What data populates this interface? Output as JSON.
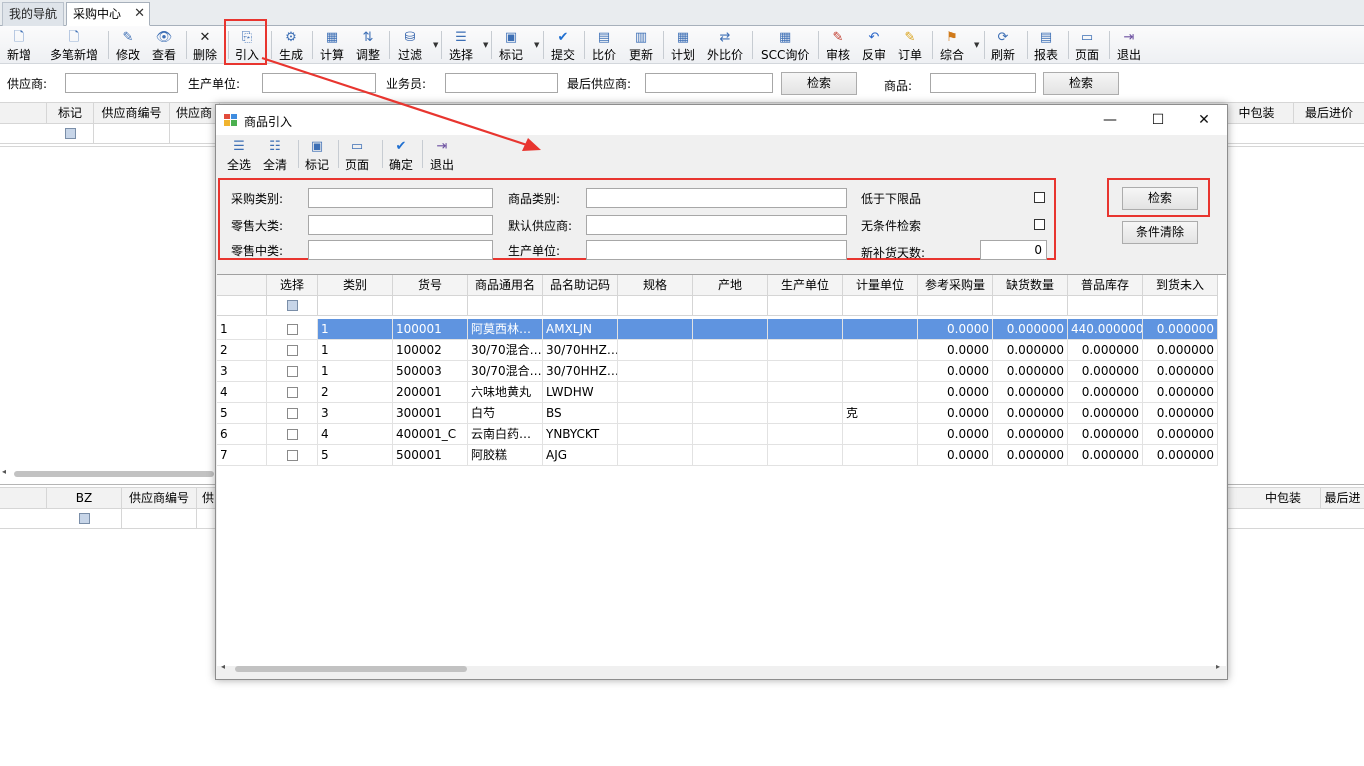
{
  "tabs": [
    "我的导航",
    "采购中心"
  ],
  "tab_close": "✕",
  "toolbar": {
    "items": [
      {
        "label": "新增",
        "icon": "new-doc-icon"
      },
      {
        "label": "多笔新增",
        "icon": "multi-new-icon"
      },
      {
        "label": "修改",
        "icon": "edit-icon"
      },
      {
        "label": "查看",
        "icon": "view-icon"
      },
      {
        "label": "删除",
        "icon": "delete-icon"
      },
      {
        "label": "引入",
        "icon": "import-icon"
      },
      {
        "label": "生成",
        "icon": "generate-icon"
      },
      {
        "label": "计算",
        "icon": "calculate-icon"
      },
      {
        "label": "调整",
        "icon": "adjust-icon"
      },
      {
        "label": "过滤",
        "icon": "filter-icon"
      },
      {
        "label": "选择",
        "icon": "select-icon"
      },
      {
        "label": "标记",
        "icon": "mark-icon"
      },
      {
        "label": "提交",
        "icon": "submit-icon"
      },
      {
        "label": "比价",
        "icon": "compare-price-icon"
      },
      {
        "label": "更新",
        "icon": "update-icon"
      },
      {
        "label": "计划",
        "icon": "plan-icon"
      },
      {
        "label": "外比价",
        "icon": "external-compare-icon"
      },
      {
        "label": "SCC询价",
        "icon": "inquiry-icon"
      },
      {
        "label": "审核",
        "icon": "audit-icon"
      },
      {
        "label": "反审",
        "icon": "unaudit-icon"
      },
      {
        "label": "订单",
        "icon": "order-icon"
      },
      {
        "label": "综合",
        "icon": "combined-icon"
      },
      {
        "label": "刷新",
        "icon": "refresh-icon"
      },
      {
        "label": "报表",
        "icon": "report-icon"
      },
      {
        "label": "页面",
        "icon": "page-icon"
      },
      {
        "label": "退出",
        "icon": "exit-icon"
      }
    ]
  },
  "filter": {
    "supplier_label": "供应商:",
    "maker_label": "生产单位:",
    "salesman_label": "业务员:",
    "last_supplier_label": "最后供应商:",
    "search_btn": "检索",
    "goods_label": "商品:",
    "search_btn2": "检索"
  },
  "top_grid": {
    "headers_left": [
      "标记",
      "供应商编号",
      "供应商"
    ],
    "headers_right": [
      "中包装",
      "最后进价"
    ]
  },
  "bottom_grid": {
    "headers_left": [
      "BZ",
      "供应商编号",
      "供"
    ],
    "headers_right": [
      "中包装",
      "最后进"
    ]
  },
  "dialog": {
    "title": "商品引入",
    "window_controls": {
      "minimize": "—",
      "maximize": "☐",
      "close": "✕"
    },
    "toolbar": [
      {
        "label": "全选",
        "icon": "select-all-icon"
      },
      {
        "label": "全清",
        "icon": "clear-all-icon"
      },
      {
        "label": "标记",
        "icon": "mark-icon"
      },
      {
        "label": "页面",
        "icon": "page-icon"
      },
      {
        "label": "确定",
        "icon": "checkmark-icon"
      },
      {
        "label": "退出",
        "icon": "exit-icon"
      }
    ],
    "form": {
      "purchase_category": "采购类别:",
      "goods_category": "商品类别:",
      "below_lower_limit": "低于下限品",
      "retail_major": "零售大类:",
      "default_supplier": "默认供应商:",
      "unconditional_search": "无条件检索",
      "retail_middle": "零售中类:",
      "maker": "生产单位:",
      "restock_days_label": "新补货天数:",
      "restock_days_value": "0"
    },
    "search_btn": "检索",
    "clear_btn": "条件清除",
    "grid": {
      "headers": [
        "选择",
        "类别",
        "货号",
        "商品通用名",
        "品名助记码",
        "规格",
        "产地",
        "生产单位",
        "计量单位",
        "参考采购量",
        "缺货数量",
        "普品库存",
        "到货未入"
      ],
      "rows": [
        {
          "n": "1",
          "cat": "1",
          "code": "100001",
          "name": "阿莫西林…",
          "mnem": "AMXLJN",
          "spec": "",
          "origin": "",
          "maker": "",
          "unit": "",
          "ref": "0.0000",
          "short": "0.000000",
          "stock": "440.000000",
          "arrive": "0.000000"
        },
        {
          "n": "2",
          "cat": "1",
          "code": "100002",
          "name": "30/70混合…",
          "mnem": "30/70HHZ…",
          "spec": "",
          "origin": "",
          "maker": "",
          "unit": "",
          "ref": "0.0000",
          "short": "0.000000",
          "stock": "0.000000",
          "arrive": "0.000000"
        },
        {
          "n": "3",
          "cat": "1",
          "code": "500003",
          "name": "30/70混合…",
          "mnem": "30/70HHZ…",
          "spec": "",
          "origin": "",
          "maker": "",
          "unit": "",
          "ref": "0.0000",
          "short": "0.000000",
          "stock": "0.000000",
          "arrive": "0.000000"
        },
        {
          "n": "4",
          "cat": "2",
          "code": "200001",
          "name": "六味地黄丸",
          "mnem": "LWDHW",
          "spec": "",
          "origin": "",
          "maker": "",
          "unit": "",
          "ref": "0.0000",
          "short": "0.000000",
          "stock": "0.000000",
          "arrive": "0.000000"
        },
        {
          "n": "5",
          "cat": "3",
          "code": "300001",
          "name": "白芍",
          "mnem": "BS",
          "spec": "",
          "origin": "",
          "maker": "",
          "unit": "克",
          "ref": "0.0000",
          "short": "0.000000",
          "stock": "0.000000",
          "arrive": "0.000000"
        },
        {
          "n": "6",
          "cat": "4",
          "code": "400001_C",
          "name": "云南白药…",
          "mnem": "YNBYCKT",
          "spec": "",
          "origin": "",
          "maker": "",
          "unit": "",
          "ref": "0.0000",
          "short": "0.000000",
          "stock": "0.000000",
          "arrive": "0.000000"
        },
        {
          "n": "7",
          "cat": "5",
          "code": "500001",
          "name": "阿胶糕",
          "mnem": "AJG",
          "spec": "",
          "origin": "",
          "maker": "",
          "unit": "",
          "ref": "0.0000",
          "short": "0.000000",
          "stock": "0.000000",
          "arrive": "0.000000"
        }
      ]
    }
  },
  "colors": {
    "highlight_red": "#e8352f",
    "selected_row": "#5f94e0"
  }
}
